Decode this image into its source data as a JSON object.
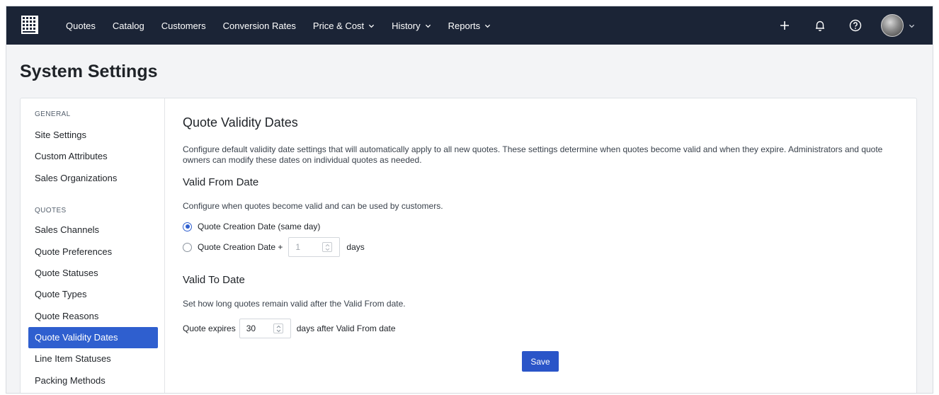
{
  "nav": {
    "items": [
      {
        "label": "Quotes",
        "dropdown": false
      },
      {
        "label": "Catalog",
        "dropdown": false
      },
      {
        "label": "Customers",
        "dropdown": false
      },
      {
        "label": "Conversion Rates",
        "dropdown": false
      },
      {
        "label": "Price & Cost",
        "dropdown": true
      },
      {
        "label": "History",
        "dropdown": true
      },
      {
        "label": "Reports",
        "dropdown": true
      }
    ],
    "icons": [
      "plus-icon",
      "bell-icon",
      "help-icon"
    ],
    "colors": {
      "background": "#1b2436",
      "text": "#ffffff"
    }
  },
  "page": {
    "title": "System Settings"
  },
  "sidebar": {
    "sections": [
      {
        "title": "GENERAL",
        "items": [
          "Site Settings",
          "Custom Attributes",
          "Sales Organizations"
        ]
      },
      {
        "title": "QUOTES",
        "items": [
          "Sales Channels",
          "Quote Preferences",
          "Quote Statuses",
          "Quote Types",
          "Quote Reasons",
          "Quote Validity Dates",
          "Line Item Statuses",
          "Packing Methods"
        ]
      }
    ],
    "active_item": "Quote Validity Dates",
    "active_color": "#2f5fcf"
  },
  "content": {
    "title": "Quote Validity Dates",
    "description": "Configure default validity date settings that will automatically apply to all new quotes. These settings determine when quotes become valid and when they expire. Administrators and quote owners can modify these dates on individual quotes as needed.",
    "valid_from": {
      "heading": "Valid From Date",
      "subtitle": "Configure when quotes become valid and can be used by customers.",
      "option1": "Quote Creation Date (same day)",
      "option2_prefix": "Quote Creation Date +",
      "option2_value": "1",
      "option2_suffix": "days",
      "selected": "option1"
    },
    "valid_to": {
      "heading": "Valid To Date",
      "subtitle": "Set how long quotes remain valid after the Valid From date.",
      "prefix": "Quote expires",
      "value": "30",
      "suffix": "days after Valid From date"
    },
    "save_label": "Save"
  }
}
